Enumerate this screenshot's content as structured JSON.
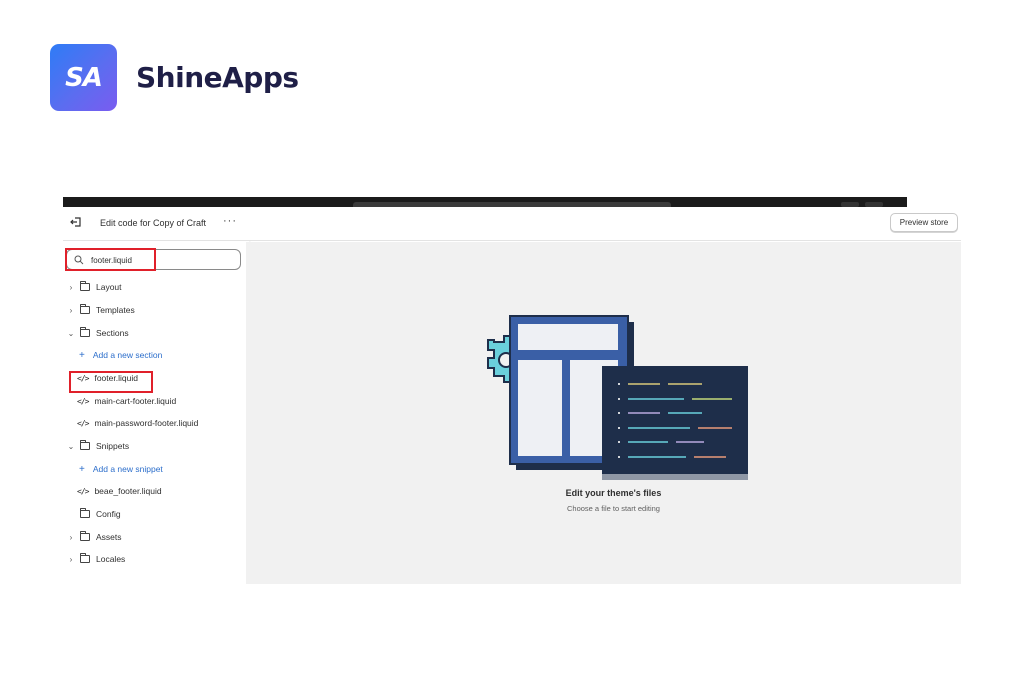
{
  "brand": {
    "logo_text": "SA",
    "name": "ShineApps",
    "logo_colors": [
      "#2e7cf6",
      "#7a5cf0"
    ]
  },
  "topbar": {
    "exit_icon": "exit-icon",
    "title": "Edit code for Copy of Craft",
    "more_label": "···",
    "preview_label": "Preview store"
  },
  "search": {
    "value": "footer.liquid",
    "icon": "search-icon"
  },
  "tree": {
    "layout": "Layout",
    "templates": "Templates",
    "sections": "Sections",
    "add_section": "Add a new section",
    "section_files": [
      "footer.liquid",
      "main-cart-footer.liquid",
      "main-password-footer.liquid"
    ],
    "snippets": "Snippets",
    "add_snippet": "Add a new snippet",
    "snippet_files": [
      "beae_footer.liquid"
    ],
    "config": "Config",
    "assets": "Assets",
    "locales": "Locales"
  },
  "empty_state": {
    "title": "Edit your theme's files",
    "subtitle": "Choose a file to start editing"
  },
  "colors": {
    "highlight": "#e0202a",
    "link": "#2c6ecb",
    "panel": "#1e2e4a",
    "theme_blue": "#3a5fa6"
  }
}
